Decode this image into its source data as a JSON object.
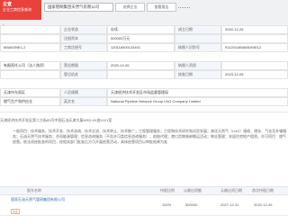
{
  "header": {
    "logo_line1": "企查",
    "logo_line2": "企业工商信息查询",
    "company_search_value": "国家管网集团天然气有限公司",
    "btn_a": "选择企业",
    "btn_b": "查看报告"
  },
  "side": {
    "user_label": "人",
    "legal_rep": "王建国",
    "related_icon": "关",
    "related_text": "关联企业 2"
  },
  "grid": {
    "rows": [
      [
        "",
        "企业状态",
        "存续",
        "成立日期",
        "2020-12-26"
      ],
      [
        "",
        "注册资本",
        "500000万元",
        "",
        ""
      ],
      [
        "MA06XNEL-2",
        "工商注册号",
        "120116000124401",
        "纳税人识别号",
        "91120116MA06XNEL2"
      ],
      [
        "有限责任公司（法人独资）",
        "营业期限",
        "2020-12-26",
        "纳税人资质",
        ""
      ],
      [
        "",
        "登记机关",
        "",
        "核准日期",
        "2023-12-05"
      ],
      [
        "天津市东丽区",
        "人员规模",
        "天津经济技术开发区市场监督管理局",
        "",
        ""
      ],
      [
        "燃气生产和供应业",
        "英文名",
        "National Pipeline Network Group LNG Company Limited",
        "",
        ""
      ]
    ]
  },
  "address": "天津经济技术开发区第二大街83号中国石油天津大厦MSD-H1座1101室",
  "scope": "一般项目：技术服务、技术开发、技术咨询、技术交流、技术转让、技术推广；工程管理服务；工程和技术研究和试验发展；液化天然气（LNG）接收、储存、气化及外输服务；石油天然气技术服务；合同能源管理；信息咨询服务（不含许可类信息咨询服务）；船舶代理；港口货物装卸搬运活动；物业管理；非居住房地产租赁。许可项目：燃气经营。依法须经批准的项目，经相关部门批准后方可开展经营活动，具体经营项目以审批结果为准",
  "shareholders": {
    "headers": [
      "股东名称",
      "持股比例",
      "认缴出资额",
      "认缴出资日期",
      "首次持股日期"
    ],
    "rows": [
      {
        "name": "国家石油天然气管网集团有限公司",
        "tag": "央企",
        "ratio": "100%",
        "amount": "500000",
        "sub_date": "2027-12-31",
        "first_date": "2020-12-26"
      }
    ]
  },
  "colors": {
    "brand_red": "#e8423b",
    "link_blue": "#2a6db6",
    "label_bg": "#f3f6fa"
  }
}
